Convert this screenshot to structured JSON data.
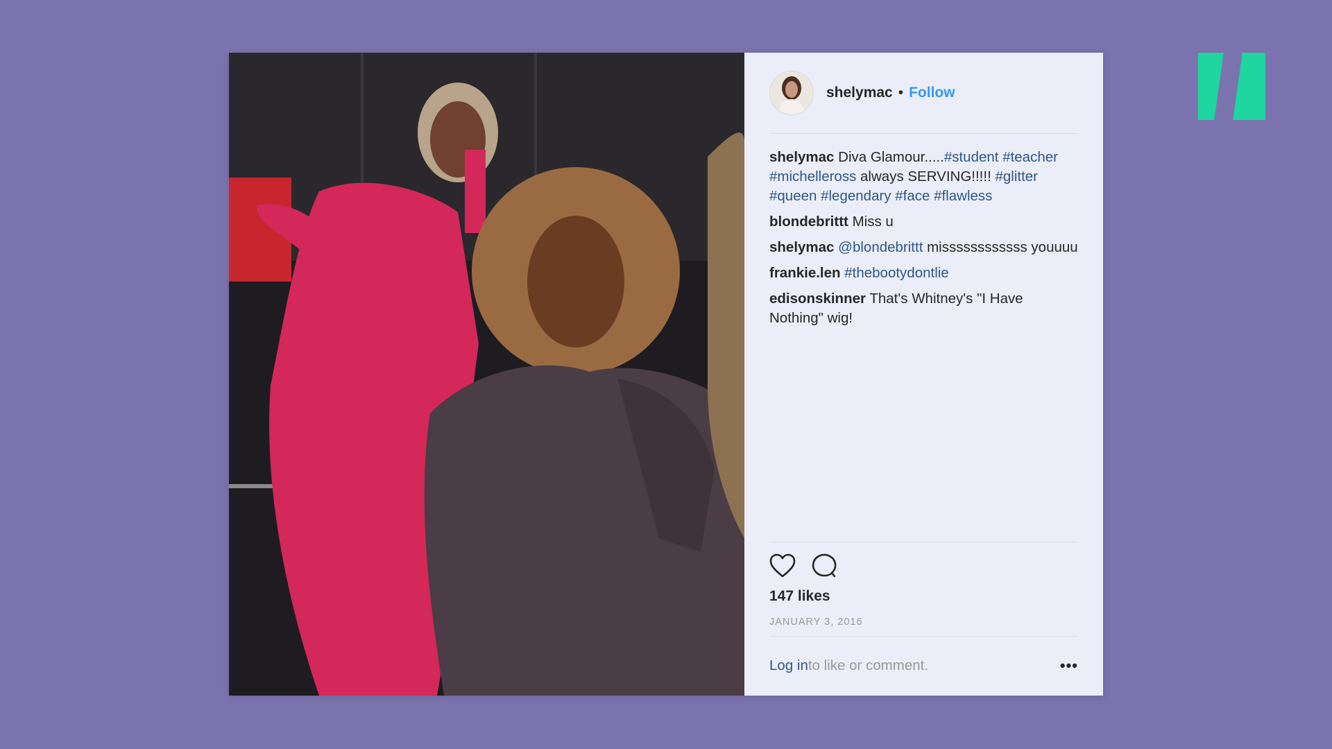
{
  "post": {
    "username": "shelymac",
    "dot": "•",
    "follow_label": "Follow",
    "caption": {
      "user": "shelymac",
      "text": "Diva Glamour.....",
      "tags_line1": "#student",
      "tags_line2a": "#teacher",
      "tags_line2b": "#michelleross",
      "text2": "always SERVING!!!!!",
      "tags_line3": "#glitter #queen #legendary #face #flawless"
    },
    "comments": [
      {
        "user": "blondebrittt",
        "text": "Miss u"
      },
      {
        "user": "shelymac",
        "mention": "@blondebrittt",
        "text": "missssssssssss youuuu"
      },
      {
        "user": "frankie.len",
        "tag": "#thebootydontlie"
      },
      {
        "user": "edisonskinner",
        "text": "That's Whitney's \"I Have Nothing\" wig!"
      }
    ],
    "likes": "147 likes",
    "date": "JANUARY 3, 2016",
    "login_label": "Log in",
    "login_suffix": " to like or comment.",
    "more_label": "•••"
  },
  "icons": {
    "like": "heart-icon",
    "comment": "comment-bubble-icon",
    "more": "ellipsis-icon",
    "brand": "huffpost-logo"
  },
  "colors": {
    "background": "#7b73ae",
    "panel": "#ebeef8",
    "follow": "#3897f0",
    "link": "#2e5586",
    "brand": "#1fd6a0"
  }
}
